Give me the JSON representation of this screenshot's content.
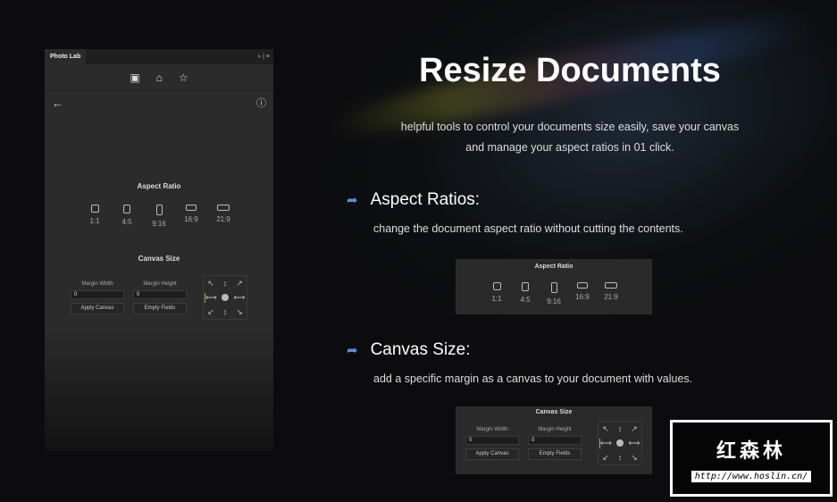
{
  "panel": {
    "tab": "Photo Lab",
    "expand": "»",
    "menu": "≡",
    "tools": [
      "▣",
      "⌂",
      "☆"
    ],
    "back": "←",
    "info": "ⓘ"
  },
  "aspect": {
    "title": "Aspect Ratio",
    "items": [
      {
        "label": "1:1",
        "w": 9,
        "h": 9
      },
      {
        "label": "4:5",
        "w": 8,
        "h": 10
      },
      {
        "label": "9:16",
        "w": 7,
        "h": 12
      },
      {
        "label": "16:9",
        "w": 12,
        "h": 7
      },
      {
        "label": "21:9",
        "w": 14,
        "h": 7
      }
    ]
  },
  "canvas": {
    "title": "Canvas Size",
    "margin_width": "Margin Width",
    "margin_height": "Margin Height",
    "width_value": "0",
    "height_value": "0",
    "apply": "Apply Canvas",
    "empty": "Empty Fields",
    "grid": [
      "↖",
      "↕",
      "↗",
      "⟷",
      "●",
      "⟷",
      "↙",
      "↕",
      "↘"
    ]
  },
  "hero": {
    "title": "Resize Documents",
    "desc1": "helpful tools to control your documents size easily, save your canvas",
    "desc2": "and manage your aspect ratios in 01 click."
  },
  "features": [
    {
      "icon": "share-arrow",
      "title": "Aspect Ratios:",
      "desc": "change the document aspect ratio without cutting the contents."
    },
    {
      "icon": "share-arrow",
      "title": "Canvas Size:",
      "desc": "add a specific margin as a canvas to your document with values."
    }
  ],
  "watermark": {
    "name": "红森林",
    "url": "http://www.hoslin.cn/"
  }
}
